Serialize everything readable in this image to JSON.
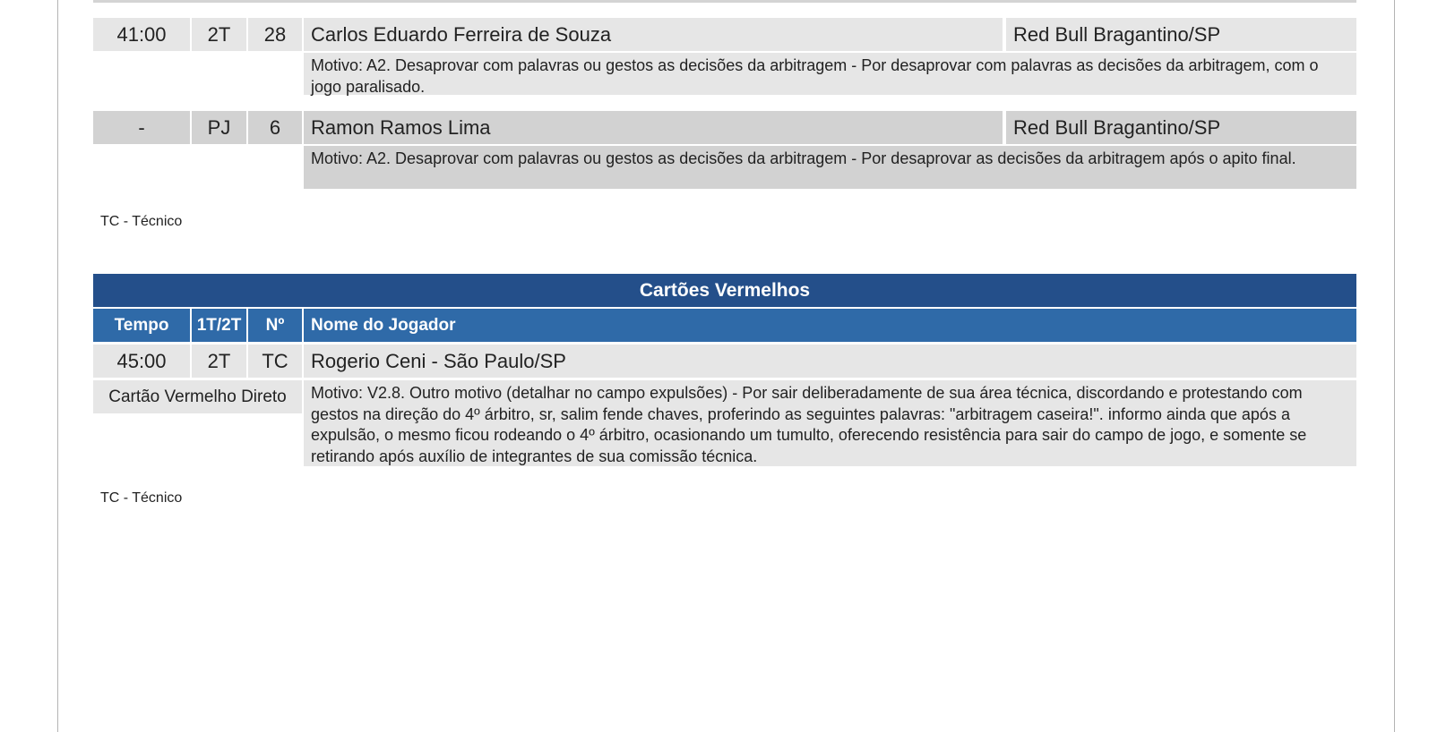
{
  "yellow_cards": {
    "rows": [
      {
        "time": "41:00",
        "half": "2T",
        "number": "28",
        "player": "Carlos Eduardo Ferreira de Souza",
        "team": "Red Bull Bragantino/SP",
        "reason": "Motivo: A2.  Desaprovar com palavras ou gestos as decisões da arbitragem  - Por desaprovar com palavras as decisões da arbitragem, com o jogo paralisado."
      },
      {
        "time": "-",
        "half": "PJ",
        "number": "6",
        "player": "Ramon Ramos Lima",
        "team": "Red Bull Bragantino/SP",
        "reason": "Motivo: A2.  Desaprovar com palavras ou gestos as decisões da arbitragem  - Por desaprovar as decisões da arbitragem após o apito final."
      }
    ],
    "legend": "TC - Técnico"
  },
  "red_cards": {
    "title": "Cartões Vermelhos",
    "headers": {
      "time": "Tempo",
      "half": "1T/2T",
      "number": "Nº",
      "player": "Nome do Jogador"
    },
    "rows": [
      {
        "time": "45:00",
        "half": "2T",
        "number": "TC",
        "player": "Rogerio Ceni - São Paulo/SP",
        "card_type": "Cartão Vermelho Direto",
        "reason": "Motivo: V2.8.  Outro motivo (detalhar no campo expulsões) - Por sair deliberadamente de sua área técnica, discordando e protestando com gestos na direção do 4º árbitro, sr, salim fende chaves, proferindo as seguintes palavras: \"arbitragem caseira!\". informo ainda que após a expulsão, o mesmo ficou rodeando o 4º árbitro, ocasionando um tumulto, oferecendo resistência para sair do campo de jogo, e somente se retirando após auxílio de integrantes de sua comissão técnica."
      }
    ],
    "legend": "TC - Técnico"
  }
}
